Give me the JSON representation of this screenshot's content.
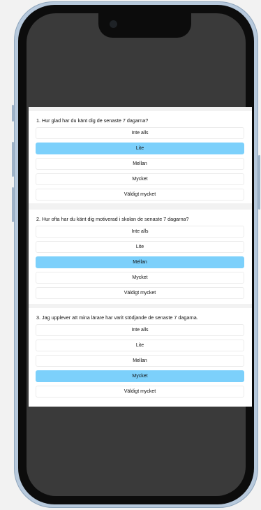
{
  "colors": {
    "selected": "#7cd0fb",
    "screen": "#3a3a3a",
    "frame": "#b7c9dc"
  },
  "questions": [
    {
      "text": "1. Hur glad har du känt dig de senaste 7 dagarna?",
      "options": [
        "Inte alls",
        "Lite",
        "Mellan",
        "Mycket",
        "Väldigt mycket"
      ],
      "selected": "Lite"
    },
    {
      "text": "2. Hur ofta har du känt dig motiverad i skolan de senaste 7 dagarna?",
      "options": [
        "Inte alls",
        "Lite",
        "Mellan",
        "Mycket",
        "Väldigt mycket"
      ],
      "selected": "Mellan"
    },
    {
      "text": "3. Jag upplever att mina lärare har varit stödjande de senaste 7 dagarna.",
      "options": [
        "Inte alls",
        "Lite",
        "Mellan",
        "Mycket",
        "Väldigt mycket"
      ],
      "selected": "Mycket"
    }
  ]
}
